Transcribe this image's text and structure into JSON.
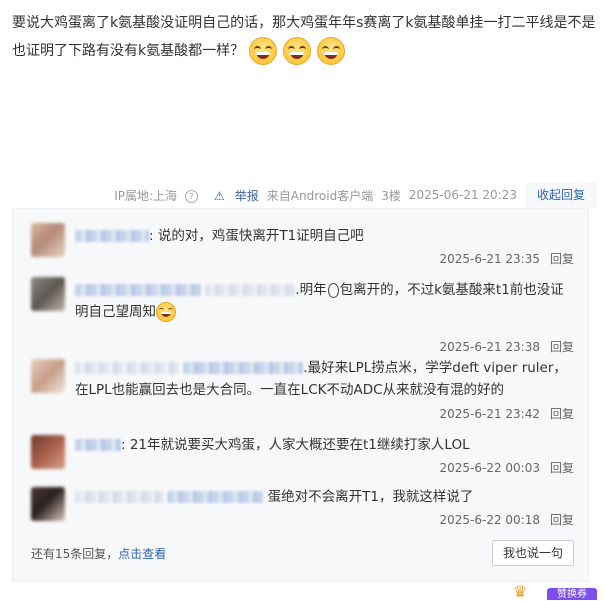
{
  "post": {
    "text": "要说大鸡蛋离了k氨基酸没证明自己的话，那大鸡蛋年年s赛离了k氨基酸单挂一打二平线是不是也证明了下路有没有k氨基酸都一样？",
    "emoji_icon": "laughing-face-icon",
    "emoji_count": 3
  },
  "meta": {
    "ip_location": "IP属地:上海",
    "report": "举报",
    "source": "来自Android客户端",
    "floor": "3楼",
    "datetime": "2025-06-21 20:23",
    "collapse_label": "收起回复"
  },
  "replies": [
    {
      "text_after": ": 说的对，鸡蛋快离开T1证明自己吧",
      "time": "2025-6-21 23:35",
      "reply_label": "回复"
    },
    {
      "text_mid": ".明年",
      "text_after": "包离开的，不过k氨基酸来t1前也没证明自己望周知",
      "time": "2025-6-21 23:38",
      "reply_label": "回复"
    },
    {
      "text_after": ".最好来LPL捞点米，学学deft viper ruler，在LPL也能赢回去也是大合同。一直在LCK不动ADC从来就没有混的好的",
      "time": "2025-6-21 23:42",
      "reply_label": "回复"
    },
    {
      "text_after": ": 21年就说要买大鸡蛋，人家大概还要在t1继续打家人LOL",
      "time": "2025-6-22 00:03",
      "reply_label": "回复"
    },
    {
      "text_after": "蛋绝对不会离开T1，我就这样说了",
      "time": "2025-6-22 00:18",
      "reply_label": "回复"
    }
  ],
  "more": {
    "prefix": "还有15条回复，",
    "link": "点击查看"
  },
  "say_button": "我也说一句",
  "badge": {
    "text": "赞换券"
  },
  "colors": {
    "link": "#2d64b3",
    "reply_bg": "#f7f8fa",
    "badge": "#7c4ef0"
  }
}
